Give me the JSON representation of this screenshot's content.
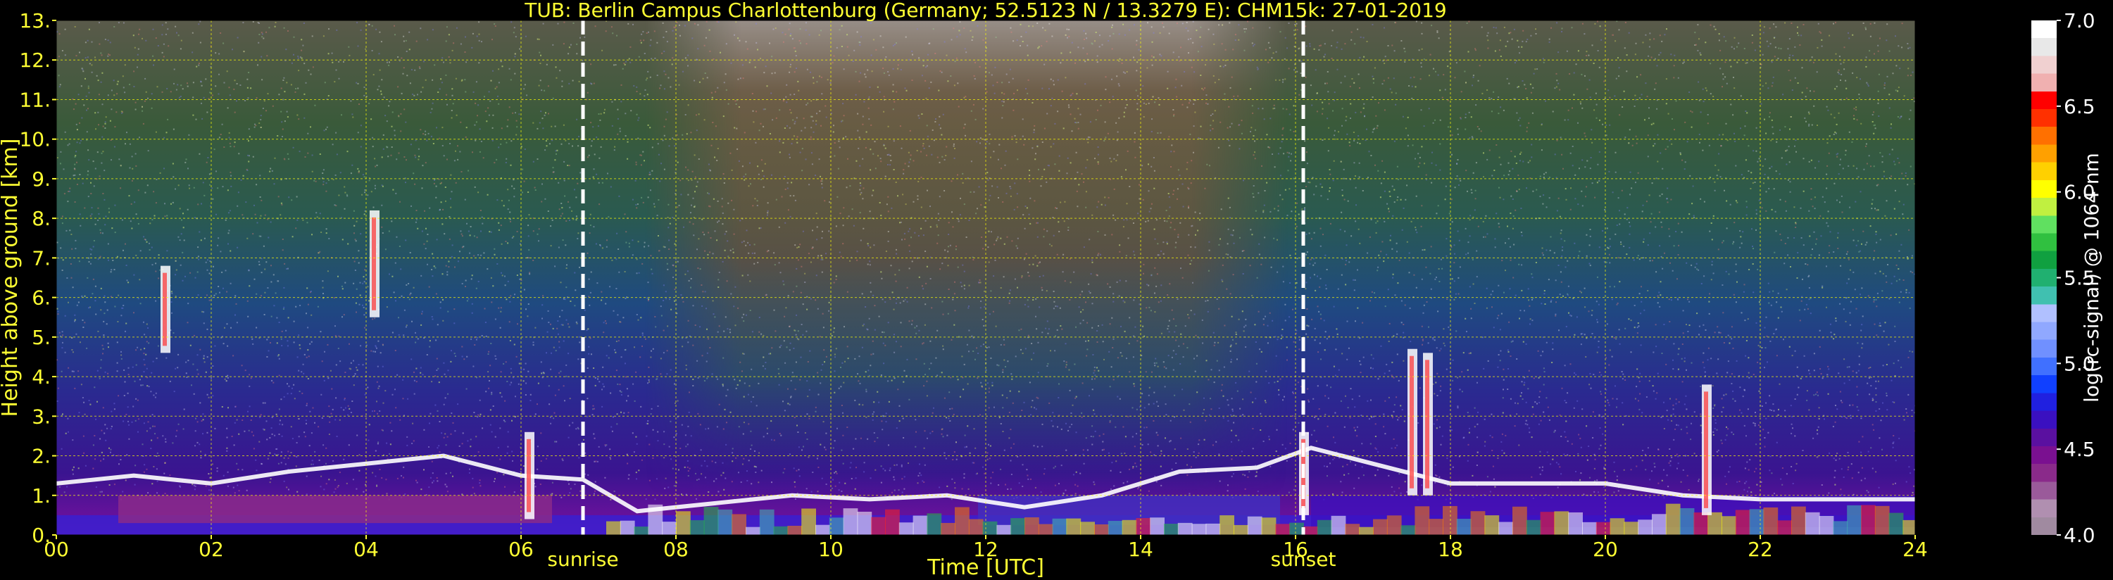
{
  "chart_data": {
    "type": "heatmap",
    "title": "TUB: Berlin Campus Charlottenburg (Germany; 52.5123 N / 13.3279 E):    CHM15k: 27-01-2019",
    "xlabel": "Time [UTC]",
    "ylabel": "Height above ground [km]",
    "xlim": [
      0,
      24
    ],
    "ylim": [
      0,
      13
    ],
    "xticks": [
      0,
      2,
      4,
      6,
      8,
      10,
      12,
      14,
      16,
      18,
      20,
      22,
      24
    ],
    "xtick_labels": [
      "00",
      "02",
      "04",
      "06",
      "08",
      "10",
      "12",
      "14",
      "16",
      "18",
      "20",
      "22",
      "24"
    ],
    "yticks": [
      0,
      1,
      2,
      3,
      4,
      5,
      6,
      7,
      8,
      9,
      10,
      11,
      12,
      13
    ],
    "ytick_labels": [
      "0.",
      "1.",
      "2.",
      "3.",
      "4.",
      "5.",
      "6.",
      "7.",
      "8.",
      "9.",
      "10.",
      "11.",
      "12.",
      "13."
    ],
    "grid": true,
    "grid_color": "#ffff00",
    "text_color": "#ffff33",
    "background": "#000000",
    "markers": [
      {
        "label": "sunrise",
        "x": 6.8
      },
      {
        "label": "sunset",
        "x": 16.1
      }
    ],
    "colorbar": {
      "label": "log(rc-signal) @ 1064 nm",
      "min": 4.0,
      "max": 7.0,
      "ticks": [
        4.0,
        4.5,
        5.0,
        5.5,
        6.0,
        6.5,
        7.0
      ],
      "tick_labels": [
        "4.0",
        "4.5",
        "5.0",
        "5.5",
        "6.0",
        "6.5",
        "7.0"
      ],
      "colors": [
        "#a08aa0",
        "#b08fb0",
        "#9a5a9a",
        "#8a2a8a",
        "#7a1090",
        "#5a10a0",
        "#3a10c0",
        "#2020e0",
        "#1040ff",
        "#4070ff",
        "#7090ff",
        "#90a8ff",
        "#b0c0ff",
        "#40c0b0",
        "#20b070",
        "#10a040",
        "#30c040",
        "#60e060",
        "#c0f040",
        "#ffff00",
        "#ffd000",
        "#ffa000",
        "#ff7000",
        "#ff3000",
        "#ff0000",
        "#f0b0b0",
        "#f0d0d0",
        "#e8e8e8",
        "#ffffff"
      ]
    }
  }
}
